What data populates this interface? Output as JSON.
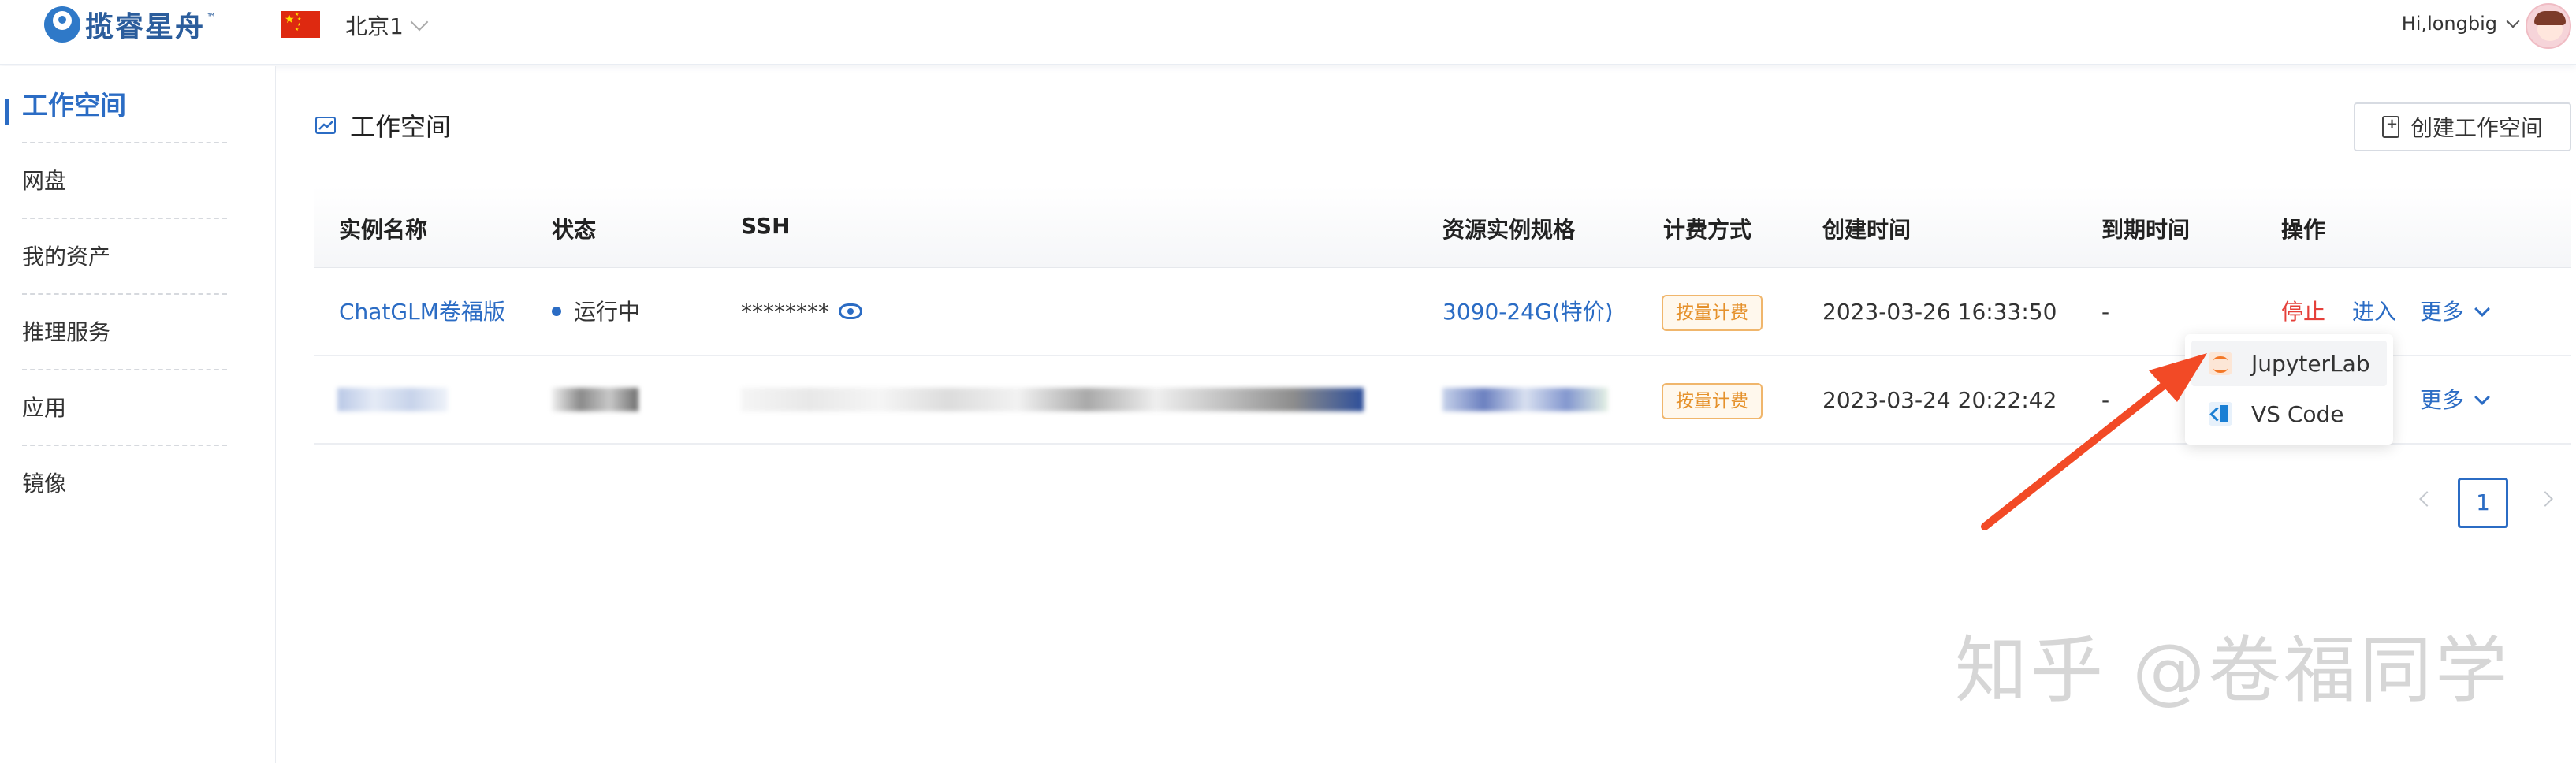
{
  "header": {
    "logo_text": "揽睿星舟",
    "logo_tm": "™",
    "region": "北京1",
    "user_greeting": "Hi,longbig"
  },
  "sidebar": {
    "items": [
      {
        "label": "工作空间",
        "active": true
      },
      {
        "label": "网盘"
      },
      {
        "label": "我的资产"
      },
      {
        "label": "推理服务"
      },
      {
        "label": "应用"
      },
      {
        "label": "镜像"
      }
    ]
  },
  "main": {
    "title": "工作空间",
    "create_button": "创建工作空间",
    "columns": [
      "实例名称",
      "状态",
      "SSH",
      "资源实例规格",
      "计费方式",
      "创建时间",
      "到期时间",
      "操作"
    ],
    "rows": [
      {
        "name": "ChatGLM卷福版",
        "status": "运行中",
        "ssh": "********",
        "spec": "3090-24G(特价)",
        "billing": "按量计费",
        "created": "2023-03-26 16:33:50",
        "expires": "-",
        "action_stop": "停止",
        "action_enter": "进入",
        "action_more": "更多"
      },
      {
        "name": "",
        "status": "",
        "ssh": "",
        "spec": "",
        "billing": "按量计费",
        "created": "2023-03-24 20:22:42",
        "expires": "-",
        "action_more": "更多"
      }
    ],
    "more_menu": [
      "JupyterLab",
      "VS Code"
    ],
    "pagination": {
      "current": "1"
    }
  },
  "watermark": "知乎 @卷福同学",
  "colors": {
    "accent": "#2b6cc4",
    "danger": "#e5403a",
    "badge": "#e5912b",
    "arrow": "#f24a26"
  }
}
